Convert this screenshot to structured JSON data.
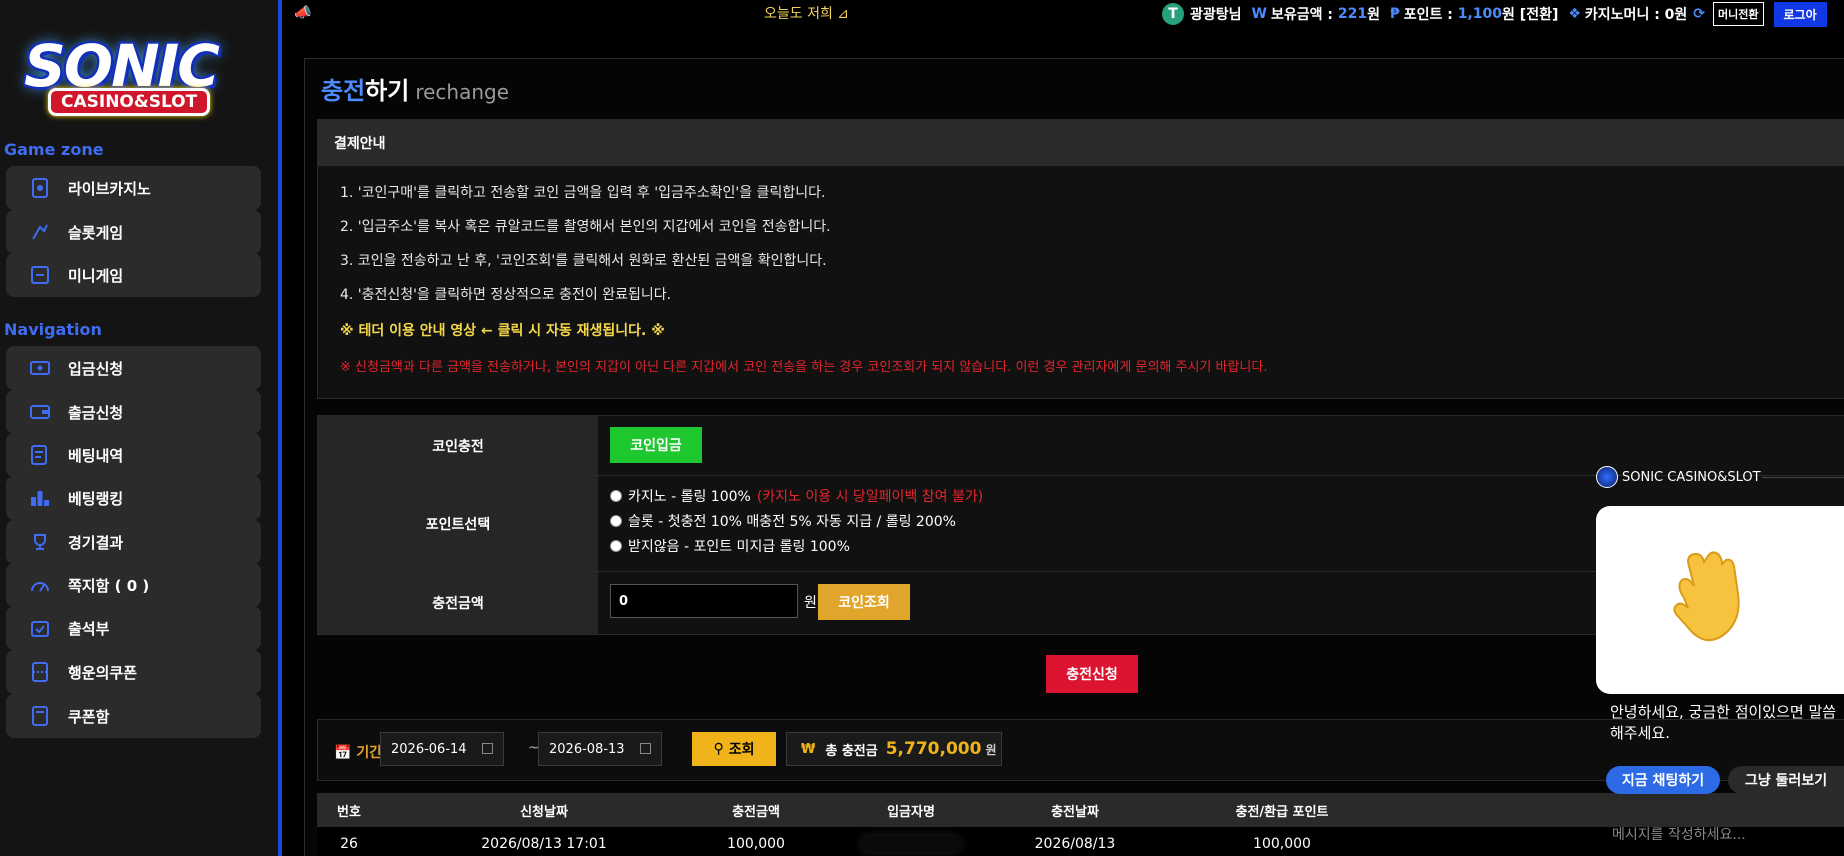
{
  "brand": {
    "logo_word": "SONIC",
    "logo_sub": "CASINO&SLOT"
  },
  "sidebar": {
    "game_zone_title": "Game zone",
    "game_items": [
      {
        "label": "라이브카지노",
        "icon": "live-casino-icon"
      },
      {
        "label": "슬롯게임",
        "icon": "slot-icon"
      },
      {
        "label": "미니게임",
        "icon": "mini-game-icon"
      }
    ],
    "navigation_title": "Navigation",
    "nav_items": [
      {
        "label": "입금신청",
        "icon": "deposit-icon"
      },
      {
        "label": "출금신청",
        "icon": "wallet-icon"
      },
      {
        "label": "베팅내역",
        "icon": "betting-history-icon"
      },
      {
        "label": "베팅랭킹",
        "icon": "ranking-icon"
      },
      {
        "label": "경기결과",
        "icon": "trophy-icon"
      },
      {
        "label": "쪽지함 ( 0 )",
        "icon": "message-icon"
      },
      {
        "label": "출석부",
        "icon": "attendance-icon"
      },
      {
        "label": "행운의쿠폰",
        "icon": "coupon-icon"
      },
      {
        "label": "쿠폰함",
        "icon": "coupon-box-icon"
      }
    ]
  },
  "topbar": {
    "marquee": "오늘도 저희 ⊿",
    "username": "광광탕님",
    "won_symbol": "W",
    "balance_label": "보유금액 :",
    "balance_value": "221",
    "balance_unit": "원",
    "point_symbol": "₱",
    "point_label": "포인트 :",
    "point_value": "1,100",
    "point_unit": "원",
    "convert_label": "[전환]",
    "casino_money_label": "카지노머니 : 0원",
    "money_switch_button": "머니전환",
    "login_button": "로그아"
  },
  "page": {
    "title_highlight": "충전",
    "title_rest": "하기",
    "title_en": "rechange"
  },
  "guide": {
    "heading": "결제안내",
    "steps": [
      "1. '코인구매'를 클릭하고 전송할 코인 금액을 입력 후 '입금주소확인'을 클릭합니다.",
      "2. '입금주소'를 복사 혹은 큐알코드를 촬영해서 본인의 지갑에서 코인을 전송합니다.",
      "3. 코인을 전송하고 난 후, '코인조회'를 클릭해서 원화로 환산된 금액을 확인합니다.",
      "4. '충전신청'을 클릭하면 정상적으로 충전이 완료됩니다."
    ],
    "video_note_prefix": "※ ",
    "video_note": "테더 이용 안내 영상 ← 클릭 시 자동 재생됩니다.",
    "video_note_suffix": " ※",
    "warning": "※ 신청금액과 다른 금액을 전송하거나, 본인의 지갑이 아닌 다른 지갑에서 코인 전송을 하는 경우 코인조회가 되지 않습니다. 이런 경우 관리자에게 문의해 주시기 바랍니다."
  },
  "form": {
    "coin_charge_label": "코인충전",
    "coin_deposit_button": "코인입금",
    "point_select_label": "포인트선택",
    "options": [
      {
        "text": "카지노 - 롤링 100%",
        "warn": "(카지노 이용 시 당일페이백 참여 불가)"
      },
      {
        "text": "슬롯 - 첫충전 10% 매충전 5% 자동 지급 / 롤링 200%",
        "warn": ""
      },
      {
        "text": "받지않음 - 포인트 미지급 롤링 100%",
        "warn": ""
      }
    ],
    "amount_label": "충전금액",
    "amount_value": "0",
    "amount_unit": "원",
    "coin_check_button": "코인조회",
    "submit_button": "충전신청"
  },
  "filter": {
    "period_label": "기간",
    "date_from": "2026-06-14",
    "tilde": "~",
    "date_to": "2026-08-13",
    "search_button": "조회",
    "total_label": "총 충전금",
    "total_symbol": "₩",
    "total_value": "5,770,000",
    "total_unit": "원"
  },
  "table": {
    "headers": [
      "번호",
      "신청날짜",
      "충전금액",
      "입금자명",
      "충전날짜",
      "충전/환급 포인트"
    ],
    "rows": [
      {
        "no": "26",
        "request_date": "2026/08/13 17:01",
        "amount": "100,000",
        "depositor": "",
        "charge_date": "2026/08/13",
        "points": "100,000"
      }
    ]
  },
  "chat": {
    "brand": "SONIC CASINO&SLOT",
    "greeting": "안녕하세요, 궁금한 점이있으면 말씀해주세요.",
    "chat_now_button": "지금 채팅하기",
    "browse_button": "그냥 둘러보기",
    "input_placeholder": "메시지를 작성하세요..."
  },
  "colors": {
    "accent_blue": "#1e48d6",
    "green_button": "#1ec72d",
    "orange_button": "#e2a52c",
    "red_button": "#dc1331",
    "warning_red": "#e2262d",
    "note_yellow": "#f5d84a"
  }
}
